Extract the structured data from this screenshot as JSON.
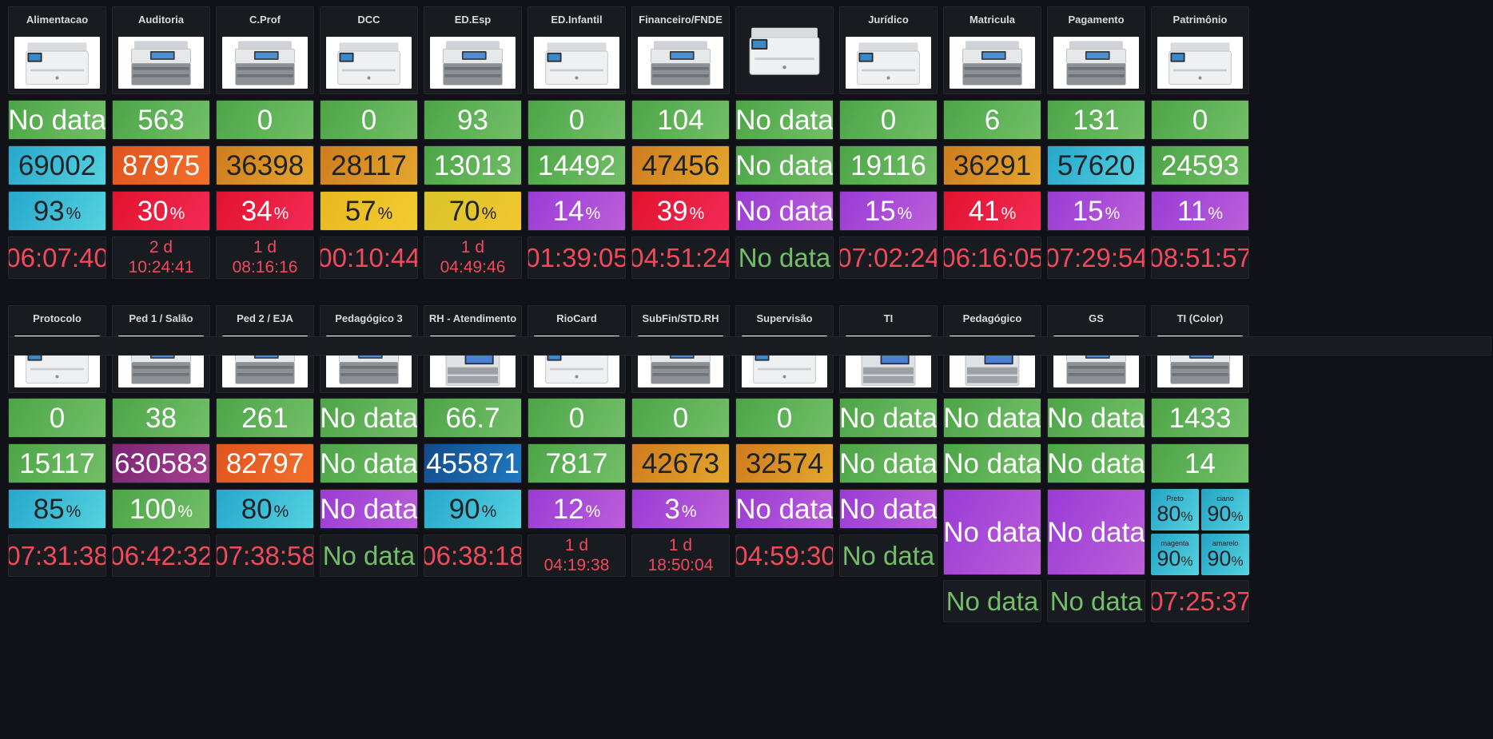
{
  "dashboard": {
    "rows": [
      {
        "printers": [
          {
            "name": "Alimentacao",
            "image": "printer-hp-icon",
            "frame": true
          },
          {
            "name": "Auditoria",
            "image": "printer-oki-icon",
            "frame": true
          },
          {
            "name": "C.Prof",
            "image": "printer-oki-icon",
            "frame": true
          },
          {
            "name": "DCC",
            "image": "printer-hp-icon",
            "frame": true
          },
          {
            "name": "ED.Esp",
            "image": "printer-oki-icon",
            "frame": true
          },
          {
            "name": "ED.Infantil",
            "image": "printer-hp-icon",
            "frame": true
          },
          {
            "name": "Financeiro/FNDE",
            "image": "printer-oki-icon",
            "frame": true
          },
          {
            "name": "",
            "image": "printer-hp-icon",
            "frame": false
          },
          {
            "name": "Jurídico",
            "image": "printer-hp-icon",
            "frame": true
          },
          {
            "name": "Matricula",
            "image": "printer-oki-icon",
            "frame": true
          },
          {
            "name": "Pagamento",
            "image": "printer-oki-icon",
            "frame": true
          },
          {
            "name": "Patrimônio",
            "image": "printer-hp-icon",
            "frame": true
          }
        ],
        "values_a": [
          "No data",
          "563",
          "0",
          "0",
          "93",
          "0",
          "104",
          "No data",
          "0",
          "6",
          "131",
          "0"
        ],
        "values_b": [
          "69002",
          "87975",
          "36398",
          "28117",
          "13013",
          "14492",
          "47456",
          "No data",
          "19116",
          "36291",
          "57620",
          "24593"
        ],
        "values_c": [
          {
            "value": "93",
            "unit": "%"
          },
          {
            "value": "30",
            "unit": "%"
          },
          {
            "value": "34",
            "unit": "%"
          },
          {
            "value": "57",
            "unit": "%"
          },
          {
            "value": "70",
            "unit": "%"
          },
          {
            "value": "14",
            "unit": "%"
          },
          {
            "value": "39",
            "unit": "%"
          },
          {
            "value": "No data",
            "unit": ""
          },
          {
            "value": "15",
            "unit": "%"
          },
          {
            "value": "41",
            "unit": "%"
          },
          {
            "value": "15",
            "unit": "%"
          },
          {
            "value": "11",
            "unit": "%"
          }
        ],
        "times": [
          {
            "line1": "06:07:40"
          },
          {
            "line1": "2 d",
            "line2": "10:24:41"
          },
          {
            "line1": "1 d",
            "line2": "08:16:16"
          },
          {
            "line1": "00:10:44"
          },
          {
            "line1": "1 d",
            "line2": "04:49:46"
          },
          {
            "line1": "01:39:05"
          },
          {
            "line1": "04:51:24"
          },
          {
            "line1": "No data"
          },
          {
            "line1": "07:02:24"
          },
          {
            "line1": "06:16:05"
          },
          {
            "line1": "07:29:54"
          },
          {
            "line1": "08:51:57"
          }
        ]
      },
      {
        "printers": [
          {
            "name": "Protocolo",
            "image": "printer-hp-icon",
            "frame": true
          },
          {
            "name": "Ped 1 / Salão",
            "image": "printer-oki-icon",
            "frame": true
          },
          {
            "name": "Ped 2 / EJA",
            "image": "printer-oki-icon",
            "frame": true
          },
          {
            "name": "Pedagógico 3",
            "image": "printer-oki-icon",
            "frame": true
          },
          {
            "name": "RH - Atendimento",
            "image": "printer-copier-icon",
            "frame": true
          },
          {
            "name": "RioCard",
            "image": "printer-hp-icon",
            "frame": true
          },
          {
            "name": "SubFin/STD.RH",
            "image": "printer-oki-icon",
            "frame": true
          },
          {
            "name": "Supervisão",
            "image": "printer-hp-icon",
            "frame": true
          },
          {
            "name": "TI",
            "image": "printer-copier-icon",
            "frame": true
          },
          {
            "name": "Pedagógico",
            "image": "printer-copier-icon",
            "frame": true
          },
          {
            "name": "GS",
            "image": "printer-oki-icon",
            "frame": true
          },
          {
            "name": "TI (Color)",
            "image": "printer-oki-icon",
            "frame": true
          }
        ],
        "values_a": [
          "0",
          "38",
          "261",
          "No data",
          "66.7",
          "0",
          "0",
          "0",
          "No data",
          "No data",
          "No data",
          "1433"
        ],
        "values_b": [
          "15117",
          "630583",
          "82797",
          "No data",
          "455871",
          "7817",
          "42673",
          "32574",
          "No data",
          "No data",
          "No data",
          "14"
        ],
        "values_c": [
          {
            "value": "85",
            "unit": "%"
          },
          {
            "value": "100",
            "unit": "%"
          },
          {
            "value": "80",
            "unit": "%"
          },
          {
            "value": "No data",
            "unit": ""
          },
          {
            "value": "90",
            "unit": "%"
          },
          {
            "value": "12",
            "unit": "%"
          },
          {
            "value": "3",
            "unit": "%"
          },
          {
            "value": "No data",
            "unit": ""
          },
          {
            "value": "No data",
            "unit": ""
          }
        ],
        "times": [
          {
            "line1": "07:31:38"
          },
          {
            "line1": "06:42:32"
          },
          {
            "line1": "07:38:58"
          },
          {
            "line1": "No data"
          },
          {
            "line1": "06:38:18"
          },
          {
            "line1": "1 d",
            "line2": "04:19:38"
          },
          {
            "line1": "1 d",
            "line2": "18:50:04"
          },
          {
            "line1": "04:59:30"
          },
          {
            "line1": "No data"
          }
        ],
        "tall_toner": [
          {
            "value": "No data"
          },
          {
            "value": "No data"
          }
        ],
        "color_toner": [
          {
            "label": "Preto",
            "value": "80",
            "unit": "%"
          },
          {
            "label": "ciano",
            "value": "90",
            "unit": "%"
          },
          {
            "label": "magenta",
            "value": "90",
            "unit": "%"
          },
          {
            "label": "amarelo",
            "value": "90",
            "unit": "%"
          }
        ],
        "extra_times": [
          {
            "line1": "No data"
          },
          {
            "line1": "No data"
          },
          {
            "line1": "07:25:37"
          }
        ]
      }
    ],
    "colors": {
      "ok": "#73bf69",
      "alert": "#f2495c",
      "panel_bg": "#181b1f",
      "page_bg": "#111217"
    }
  }
}
